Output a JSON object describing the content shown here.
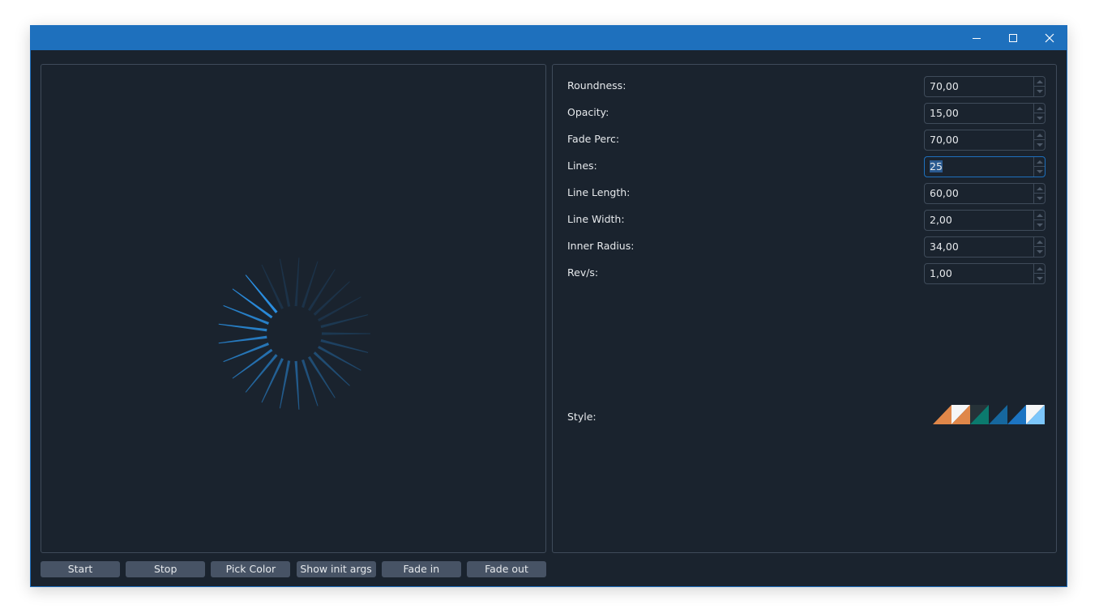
{
  "window": {
    "title": "",
    "controls": {
      "minimize": "minimize-icon",
      "maximize": "maximize-icon",
      "close": "close-icon"
    },
    "colors": {
      "titlebar": "#1e70bd",
      "background": "#1a232e",
      "border": "#3f4b5a"
    }
  },
  "spinner": {
    "roundness": 70,
    "opacity": 15,
    "fade_perc": 70,
    "lines": 25,
    "line_length": 60,
    "line_width": 2,
    "inner_radius": 34,
    "revs_per_sec": 1,
    "color": "#2a8ee0",
    "current_head_fraction": 0.74
  },
  "settings": {
    "fields": [
      {
        "label": "Roundness:",
        "value": "70,00"
      },
      {
        "label": "Opacity:",
        "value": "15,00"
      },
      {
        "label": "Fade Perc:",
        "value": "70,00"
      },
      {
        "label": "Lines:",
        "value": "25",
        "focused": true,
        "selected": true
      },
      {
        "label": "Line Length:",
        "value": "60,00"
      },
      {
        "label": "Line Width:",
        "value": "2,00"
      },
      {
        "label": "Inner Radius:",
        "value": "34,00"
      },
      {
        "label": "Rev/s:",
        "value": "1,00"
      }
    ],
    "style": {
      "label": "Style:",
      "swatches": [
        {
          "name": "orange-transparent",
          "top": "transparent",
          "bottom": "#e08749"
        },
        {
          "name": "white-orange",
          "top": "#f5f6f7",
          "bottom": "#e08749"
        },
        {
          "name": "dark-teal",
          "top": "#263238",
          "bottom": "#0b7a6e"
        },
        {
          "name": "dark-blue",
          "top": "transparent",
          "bottom": "#16679e"
        },
        {
          "name": "blue",
          "top": "transparent",
          "bottom": "#1c74c2"
        },
        {
          "name": "white-lightblue",
          "top": "#f5f6f7",
          "bottom": "#7cc6fb"
        }
      ]
    }
  },
  "buttons": [
    {
      "name": "start-button",
      "label": "Start"
    },
    {
      "name": "stop-button",
      "label": "Stop"
    },
    {
      "name": "pick-color-button",
      "label": "Pick Color"
    },
    {
      "name": "show-init-args-button",
      "label": "Show init args"
    },
    {
      "name": "fade-in-button",
      "label": "Fade in"
    },
    {
      "name": "fade-out-button",
      "label": "Fade out"
    }
  ]
}
